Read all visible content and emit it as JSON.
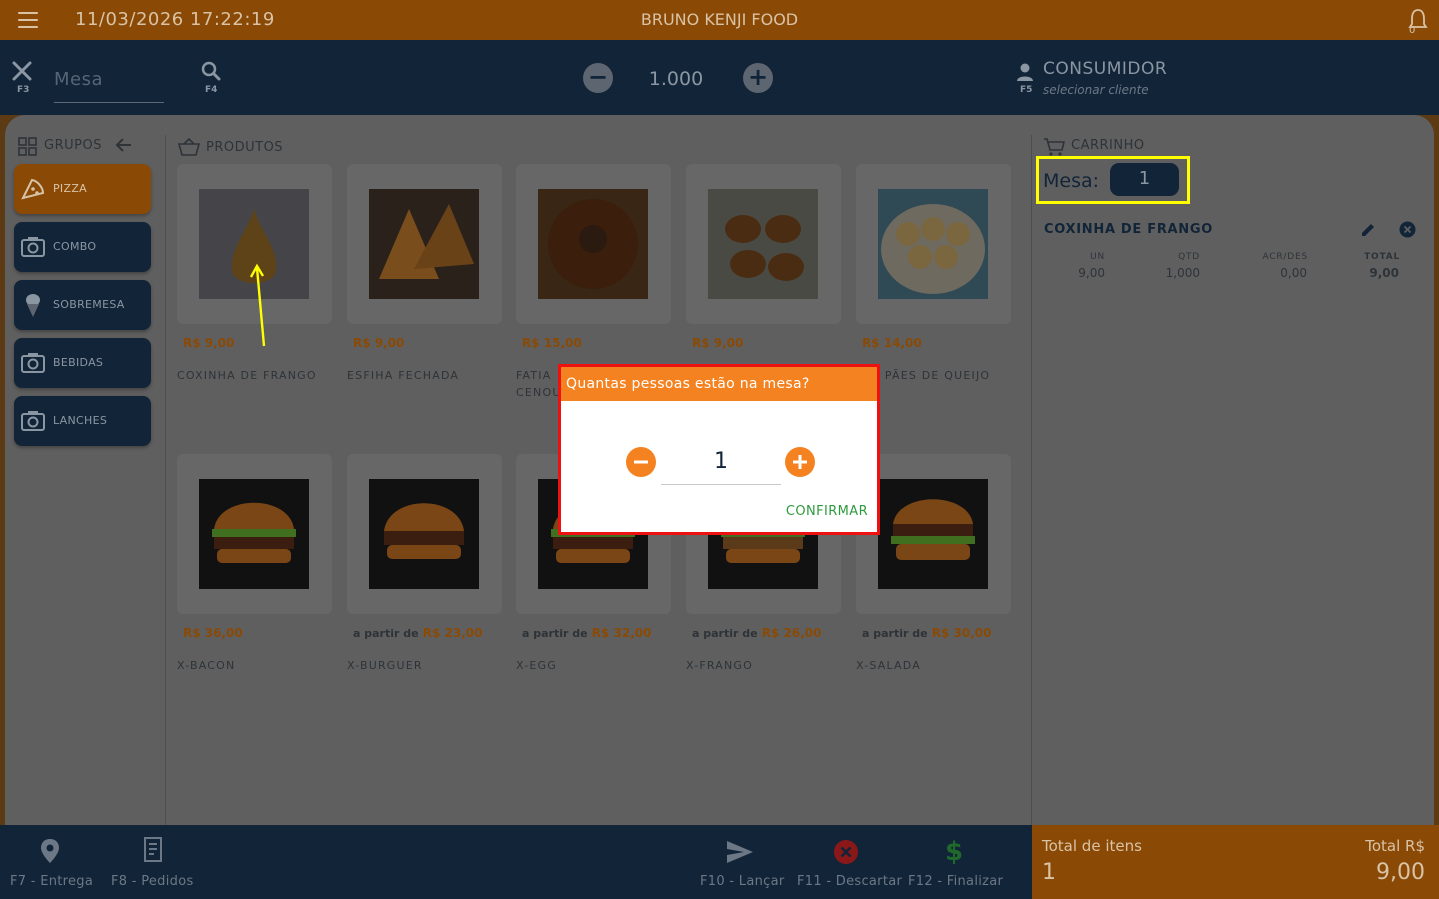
{
  "topbar": {
    "datetime": "11/03/2026 17:22:19",
    "app_name": "BRUNO KENJI FOOD",
    "bell_count": "0"
  },
  "toolbar": {
    "mesa_key": "F3",
    "mesa_placeholder": "Mesa",
    "search_key": "F4",
    "quantity": "1.000",
    "consumer_key": "F5",
    "consumer_title": "CONSUMIDOR",
    "consumer_sub": "selecionar cliente"
  },
  "groups": {
    "title": "GRUPOS",
    "items": [
      {
        "label": "PIZZA",
        "icon": "pizza-icon",
        "active": true
      },
      {
        "label": "COMBO",
        "icon": "camera-icon",
        "active": false
      },
      {
        "label": "SOBREMESA",
        "icon": "ice-cream-icon",
        "active": false
      },
      {
        "label": "BEBIDAS",
        "icon": "camera-icon",
        "active": false
      },
      {
        "label": "LANCHES",
        "icon": "camera-icon",
        "active": false
      }
    ]
  },
  "products": {
    "title": "PRODUTOS",
    "items": [
      {
        "price_prefix": "",
        "price": "R$ 9,00",
        "name": "COXINHA DE FRANGO"
      },
      {
        "price_prefix": "",
        "price": "R$ 9,00",
        "name": "ESFIHA FECHADA"
      },
      {
        "price_prefix": "",
        "price": "R$ 15,00",
        "name": "FATIA",
        "name2": "CENOU"
      },
      {
        "price_prefix": "",
        "price": "R$ 9,00",
        "name": ""
      },
      {
        "price_prefix": "",
        "price": "R$ 14,00",
        "name": "E PÃES DE QUEIJO"
      },
      {
        "price_prefix": "",
        "price": "R$ 36,00",
        "name": "X-BACON"
      },
      {
        "price_prefix": "a partir de",
        "price": "R$ 23,00",
        "name": "X-BURGUER"
      },
      {
        "price_prefix": "a partir de",
        "price": "R$ 32,00",
        "name": "X-EGG"
      },
      {
        "price_prefix": "a partir de",
        "price": "R$ 26,00",
        "name": "X-FRANGO"
      },
      {
        "price_prefix": "a partir de",
        "price": "R$ 30,00",
        "name": "X-SALADA"
      }
    ]
  },
  "cart": {
    "title": "CARRINHO",
    "mesa_label": "Mesa:",
    "mesa_value": "1",
    "item": {
      "name": "COXINHA DE FRANGO",
      "headers": [
        "UN",
        "QTD",
        "ACR/DES",
        "TOTAL"
      ],
      "values": [
        "9,00",
        "1,000",
        "0,00",
        "9,00"
      ]
    }
  },
  "bottom": {
    "entrega": "F7 - Entrega",
    "pedidos": "F8 - Pedidos",
    "lancar": "F10 - Lançar",
    "descartar": "F11 - Descartar",
    "finalizar": "F12 - Finalizar"
  },
  "totals": {
    "items_label": "Total de itens",
    "items_value": "1",
    "total_label": "Total R$",
    "total_value": "9,00"
  },
  "dialog": {
    "title": "Quantas pessoas estão na mesa?",
    "value": "1",
    "confirm": "CONFIRMAR"
  },
  "colors": {
    "dark_navy": "#122438",
    "brown": "#8a4a05",
    "orange": "#f58220",
    "confirm_green": "#2e9a3e",
    "highlight_yellow": "#ffff00",
    "dialog_border": "#ee1111"
  }
}
